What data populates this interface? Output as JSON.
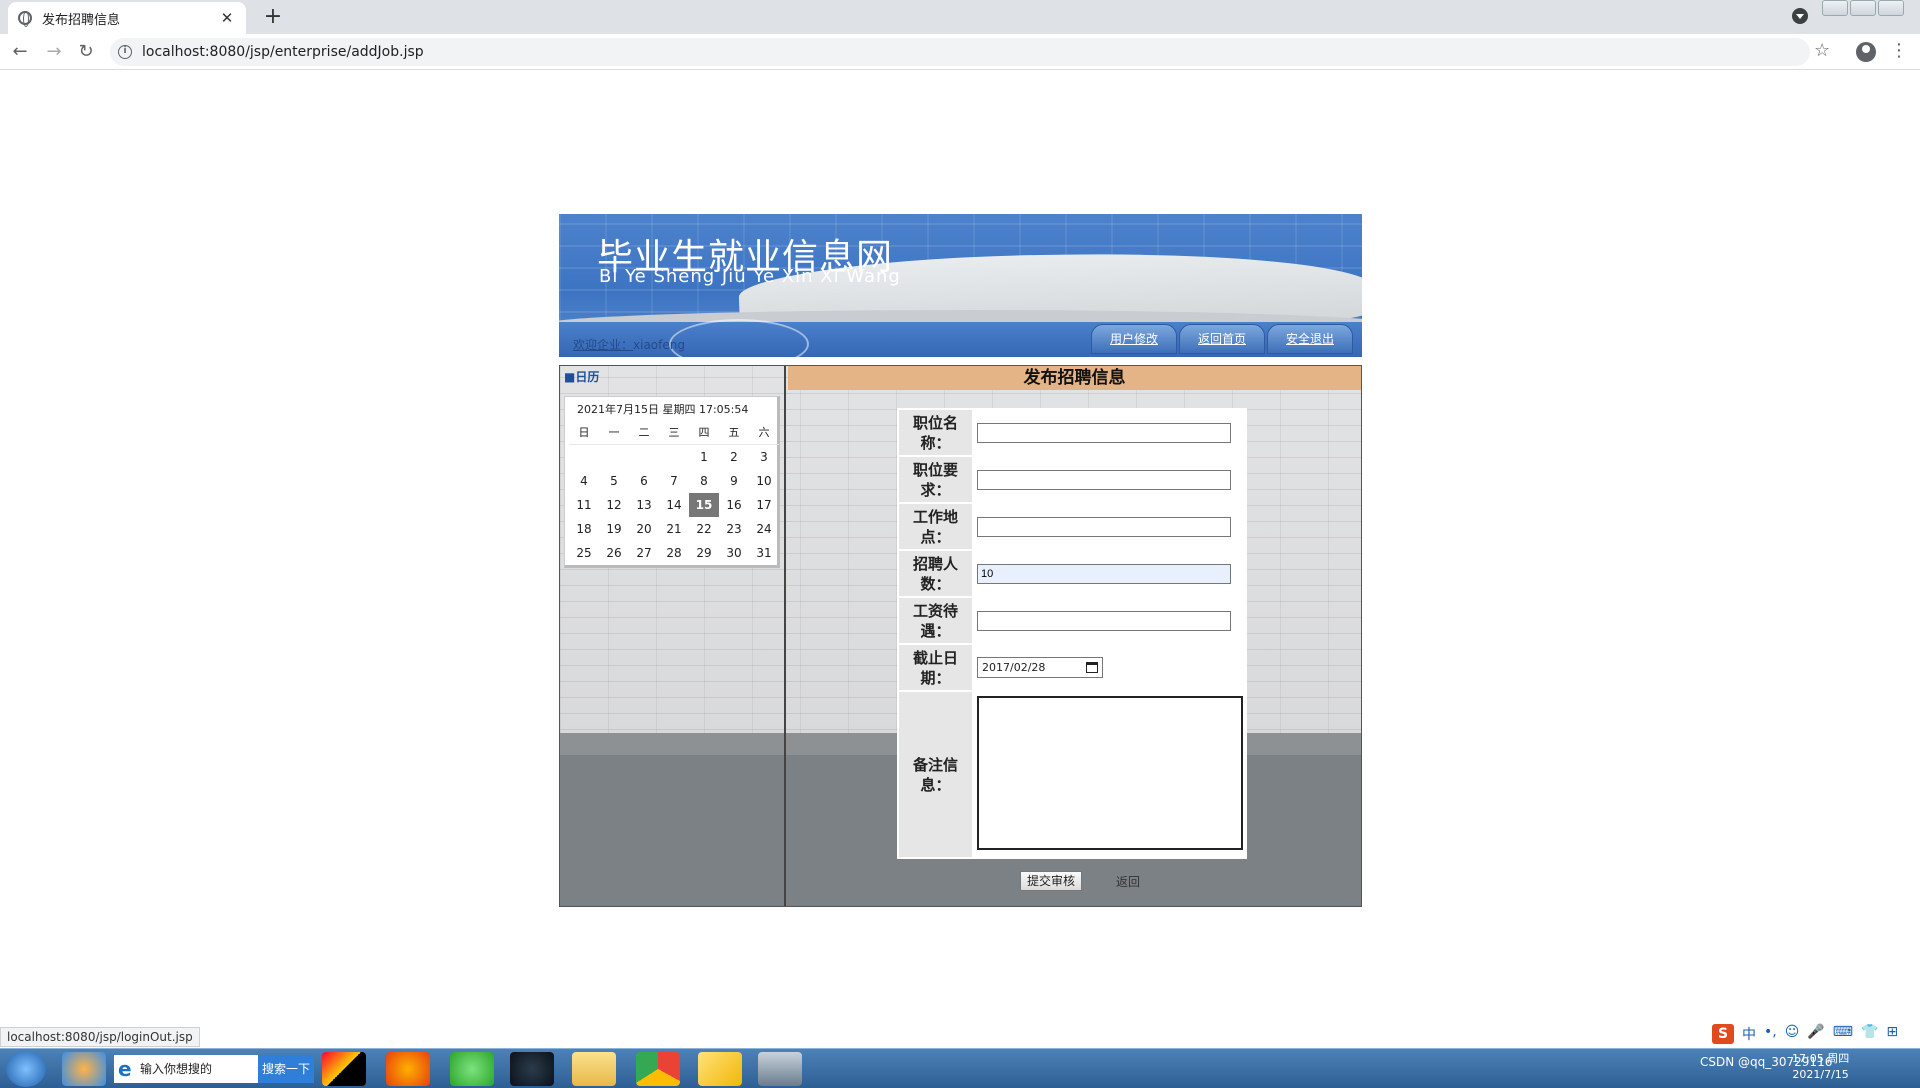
{
  "browser": {
    "tab_title": "发布招聘信息",
    "tab_close": "✕",
    "new_tab": "+",
    "url": "localhost:8080/jsp/enterprise/addJob.jsp",
    "back": "←",
    "forward": "→",
    "reload": "↻",
    "star": "☆",
    "menu": "⋮",
    "status_url": "localhost:8080/jsp/loginOut.jsp"
  },
  "header": {
    "site_title_cn": "毕业生就业信息网",
    "site_title_pinyin": "Bi Ye Sheng Jiu Ye Xin Xi Wang",
    "welcome_prefix": "欢迎企业：",
    "welcome_user": "xiaofeng",
    "nav": [
      {
        "label": "用户修改"
      },
      {
        "label": "返回首页"
      },
      {
        "label": "安全退出"
      }
    ]
  },
  "calendar": {
    "heading": "■日历",
    "datetime": "2021年7月15日 星期四 17:05:54",
    "weekdays": [
      "日",
      "一",
      "二",
      "三",
      "四",
      "五",
      "六"
    ],
    "today": 15,
    "leading_blanks": 4,
    "days": [
      1,
      2,
      3,
      4,
      5,
      6,
      7,
      8,
      9,
      10,
      11,
      12,
      13,
      14,
      15,
      16,
      17,
      18,
      19,
      20,
      21,
      22,
      23,
      24,
      25,
      26,
      27,
      28,
      29,
      30,
      31
    ]
  },
  "form": {
    "title": "发布招聘信息",
    "fields": [
      {
        "label": "职位名称：",
        "value": ""
      },
      {
        "label": "职位要求：",
        "value": ""
      },
      {
        "label": "工作地点：",
        "value": ""
      },
      {
        "label": "招聘人数：",
        "value": "10"
      },
      {
        "label": "工资待遇：",
        "value": ""
      },
      {
        "label": "截止日期：",
        "value": "2017/02/28"
      },
      {
        "label": "备注信息：",
        "value": ""
      }
    ],
    "submit_label": "提交审核",
    "back_label": "返回"
  },
  "taskbar": {
    "search_placeholder": "输入你想搜的",
    "search_button": "搜索一下",
    "tray_text": "CSDN @qq_30729116",
    "clock_time": "17:05 周四",
    "clock_date": "2021/7/15"
  },
  "ime": {
    "items": [
      "S",
      "中",
      "•,",
      "☺",
      "🎤",
      "⌨",
      "👕",
      "⊞"
    ]
  },
  "colors": {
    "banner_blue": "#3d74c2",
    "form_title_bg": "#e4b486",
    "label_bg": "#e6e6e6",
    "today_bg": "#777777"
  }
}
